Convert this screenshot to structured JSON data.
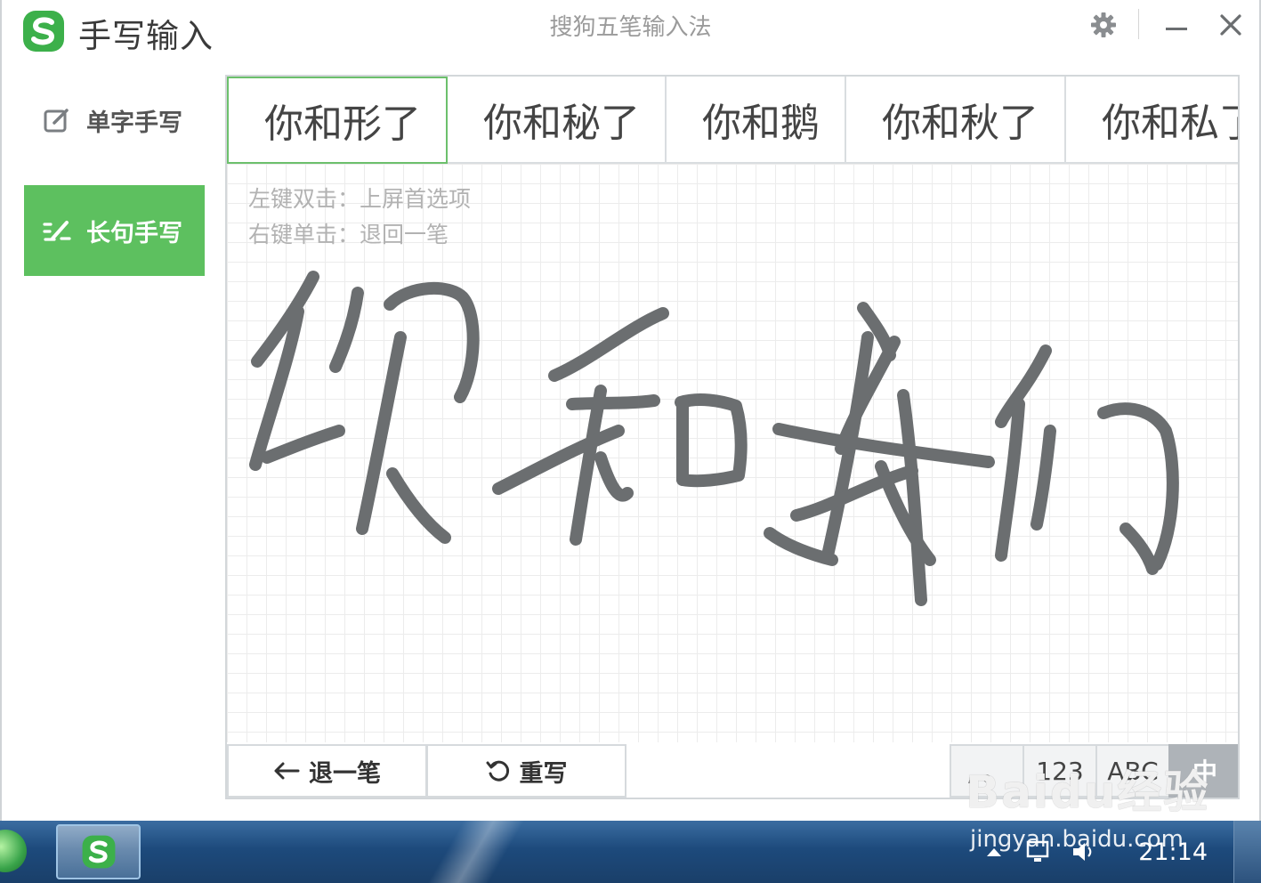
{
  "titlebar": {
    "app_title": "手写输入",
    "window_caption": "搜狗五笔输入法",
    "settings_icon": "gear-icon",
    "minimize_icon": "minimize-icon",
    "close_icon": "close-icon"
  },
  "sidebar": {
    "items": [
      {
        "label": "单字手写",
        "icon": "edit-icon",
        "active": false
      },
      {
        "label": "长句手写",
        "icon": "sentence-handwriting-icon",
        "active": true
      }
    ]
  },
  "candidates": [
    {
      "text": "你和形了",
      "selected": true
    },
    {
      "text": "你和秘了",
      "selected": false
    },
    {
      "text": "你和鹅",
      "selected": false
    },
    {
      "text": "你和秋了",
      "selected": false
    },
    {
      "text": "你和私了",
      "selected": false
    }
  ],
  "canvas": {
    "hint_double_click": "左键双击：上屏首选项",
    "hint_right_click": "右键单击：退回一笔",
    "handwritten_text": "你和我们"
  },
  "toolbar": {
    "undo_label": "退一笔",
    "rewrite_label": "重写",
    "modes": [
      {
        "label": ", 。",
        "active": false
      },
      {
        "label": "123",
        "active": false
      },
      {
        "label": "ABC",
        "active": false
      },
      {
        "label": "中",
        "active": true
      }
    ]
  },
  "taskbar": {
    "clock": "21:14"
  },
  "watermark": {
    "text": "Baidu经验",
    "url": "jingyan.baidu.com"
  },
  "colors": {
    "accent_green": "#5dc05f",
    "stroke_gray": "#6b6e70",
    "taskbar_blue": "#1d4a7c"
  }
}
